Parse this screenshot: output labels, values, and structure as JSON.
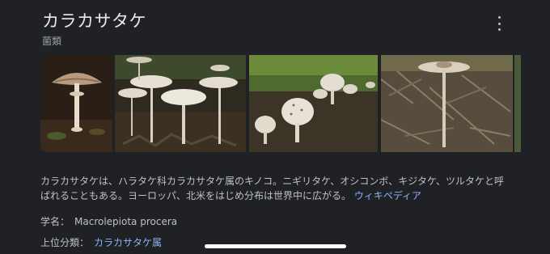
{
  "header": {
    "title": "カラカサタケ",
    "subtitle": "菌類"
  },
  "menu": {
    "icon": "more-vert-icon"
  },
  "gallery": {
    "count_visible": 4
  },
  "description": {
    "text": "カラカサタケは、ハラタケ科カラカサタケ属のキノコ。ニギリタケ、オシコンボ、キジタケ、ツルタケと呼ばれることもある。ヨーロッパ、北米をはじめ分布は世界中に広がる。",
    "source_link": "ウィキペディア"
  },
  "facts": [
    {
      "label": "学名：",
      "value": "Macrolepiota procera"
    },
    {
      "label": "上位分類：",
      "value": "カラカサタケ属"
    }
  ],
  "colors": {
    "background": "#202124",
    "link": "#8ab4f8",
    "text": "#bdc1c6"
  }
}
